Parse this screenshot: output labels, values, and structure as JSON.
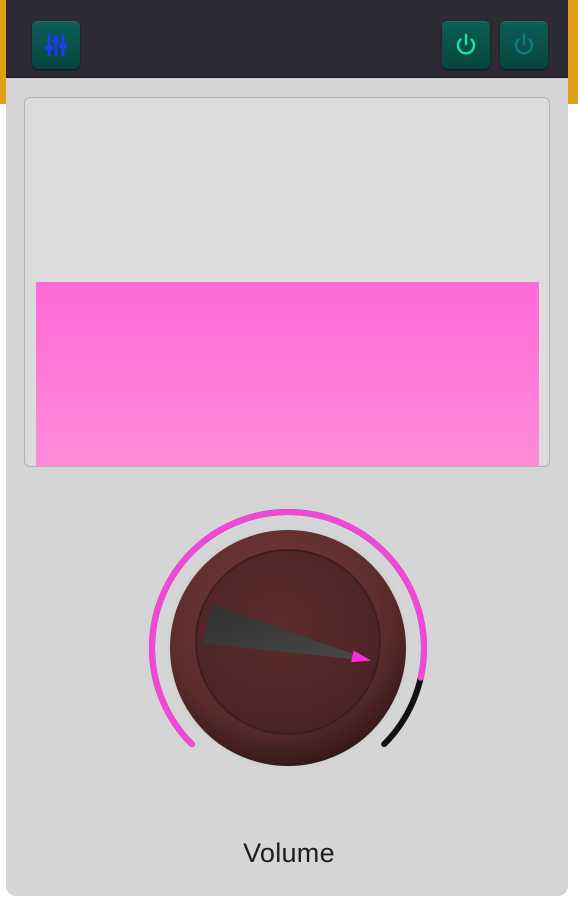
{
  "toolbar": {
    "left_button": {
      "icon": "sliders-icon",
      "color": "#1d3cff"
    },
    "right_buttons": [
      {
        "icon": "power-icon",
        "state": "on",
        "color": "#1fe3a0"
      },
      {
        "icon": "power-icon",
        "state": "off",
        "color": "#0a7c86"
      }
    ],
    "button_bg": "#0b5f56",
    "bg": "#2e2b36"
  },
  "level_meter": {
    "level": 0.5,
    "fill_color": "#ff6ad7"
  },
  "volume_knob": {
    "value": 0.88,
    "arc_color": "#f247d8",
    "knob_color": "#5a2b2b",
    "pointer_color": "#ff2bd6",
    "label": "Volume"
  }
}
